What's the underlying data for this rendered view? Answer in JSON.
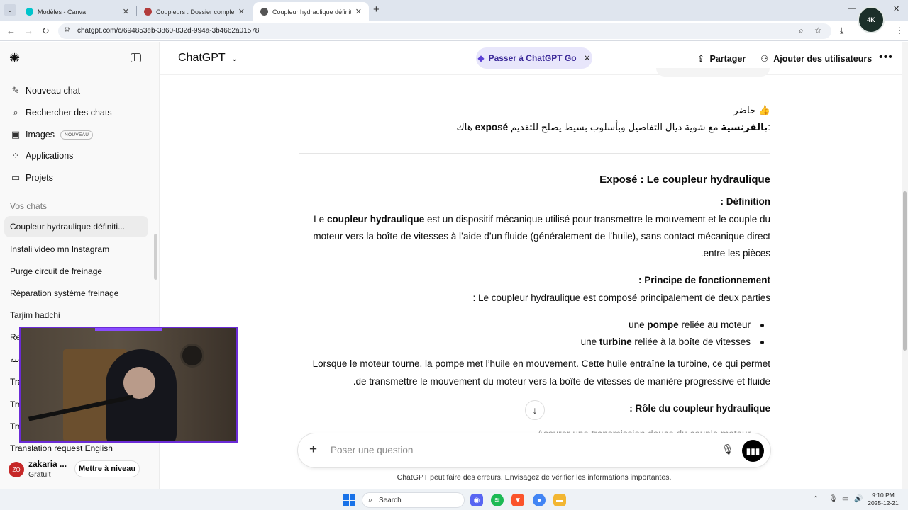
{
  "browser": {
    "tabs": [
      {
        "title": "Modèles - Canva",
        "favicon_color": "#00c4cc",
        "active": false
      },
      {
        "title": "Coupleurs : Dossier complet | T",
        "favicon_color": "#b23b3b",
        "active": false
      },
      {
        "title": "Coupleur hydraulique définitio",
        "favicon_color": "#555555",
        "active": true
      }
    ],
    "url": "chatgpt.com/c/694853eb-3860-832d-994a-3b4662a01578",
    "profile_badge": "4K"
  },
  "sidebar": {
    "actions": [
      {
        "label": "Nouveau chat",
        "icon": "edit-icon"
      },
      {
        "label": "Rechercher des chats",
        "icon": "search-icon"
      },
      {
        "label": "Images",
        "icon": "image-icon",
        "badge": "NOUVEAU"
      },
      {
        "label": "Applications",
        "icon": "apps-icon"
      },
      {
        "label": "Projets",
        "icon": "folder-icon"
      }
    ],
    "section_title": "Vos chats",
    "chats": [
      "Coupleur hydraulique définiti...",
      "Instali video mn Instagram",
      "Purge circuit de freinage",
      "Réparation système freinage",
      "Tarjim hadchi",
      "Re",
      "نية",
      "Tra",
      "Tra",
      "Tra",
      "Translation request English"
    ],
    "user": {
      "initials": "ZO",
      "name": "zakaria ...",
      "plan": "Gratuit",
      "upgrade_label": "Mettre à niveau"
    }
  },
  "header": {
    "model": "ChatGPT",
    "go_pill": "Passer à ChatGPT Go",
    "share": "Partager",
    "add_users": "Ajouter des utilisateurs"
  },
  "conversation": {
    "intro_line1": "حاضر 👍",
    "intro_line2_pre": "هاك ",
    "intro_line2_bold": "exposé بالفرنسية",
    "intro_line2_post": " مع شوية ديال التفاصيل وبأسلوب بسيط يصلح للتقديم:",
    "title": "Exposé : Le coupleur hydraulique",
    "definition_heading": ": Définition",
    "def_line1_pre": "Le ",
    "def_line1_bold": "coupleur hydraulique",
    "def_line1_post": " est un dispositif mécanique utilisé pour transmettre le mouvement et le couple du",
    "def_line2": "moteur vers la boîte de vitesses à l’aide d’un fluide (généralement de l’huile), sans contact mécanique direct",
    "def_line3": ".entre les pièces",
    "principle_heading": ": Principe de fonctionnement",
    "principle_line": ": Le coupleur hydraulique est composé principalement de deux parties",
    "bullet1_pre": "une ",
    "bullet1_bold": "pompe",
    "bullet1_post": " reliée au moteur",
    "bullet2_pre": "une ",
    "bullet2_bold": "turbine",
    "bullet2_post": " reliée à la boîte de vitesses",
    "para_line1": "Lorsque le moteur tourne, la pompe met l’huile en mouvement. Cette huile entraîne la turbine, ce qui permet",
    "para_line2": ".de transmettre le mouvement du moteur vers la boîte de vitesses de manière progressive et fluide",
    "role_heading": ": Rôle du coupleur hydraulique",
    "partial_line": "Assurer une transmission douce du couple moteur"
  },
  "composer": {
    "placeholder": "Poser une question"
  },
  "disclaimer": "ChatGPT peut faire des erreurs. Envisagez de vérifier les informations importantes.",
  "taskbar": {
    "search_label": "Search",
    "time": "9:10 PM",
    "date": "2025-12-21"
  }
}
